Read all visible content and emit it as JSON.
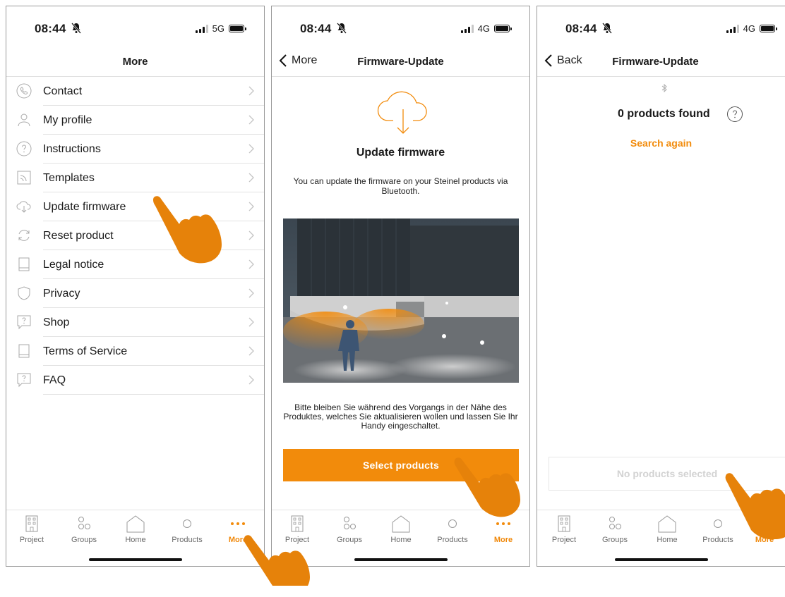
{
  "colors": {
    "accent": "#f28b0b",
    "text": "#1a1a1a",
    "muted": "#6a6a6a",
    "divider": "#e2e2e2"
  },
  "screens": [
    {
      "status": {
        "time": "08:44",
        "network": "5G"
      },
      "nav": {
        "title": "More"
      },
      "menu": [
        {
          "label": "Contact",
          "icon": "phone-icon"
        },
        {
          "label": "My profile",
          "icon": "user-icon"
        },
        {
          "label": "Instructions",
          "icon": "question-icon"
        },
        {
          "label": "Templates",
          "icon": "template-icon"
        },
        {
          "label": "Update firmware",
          "icon": "cloud-icon"
        },
        {
          "label": "Reset product",
          "icon": "reset-icon"
        },
        {
          "label": "Legal notice",
          "icon": "book-icon"
        },
        {
          "label": "Privacy",
          "icon": "shield-icon"
        },
        {
          "label": "Shop",
          "icon": "chat-question-icon"
        },
        {
          "label": "Terms of Service",
          "icon": "book-icon"
        },
        {
          "label": "FAQ",
          "icon": "chat-question-icon"
        }
      ]
    },
    {
      "status": {
        "time": "08:44",
        "network": "4G"
      },
      "nav": {
        "back": "More",
        "title": "Firmware-Update"
      },
      "heading": "Update firmware",
      "description": "You can update the firmware on your Steinel products via Bluetooth.",
      "note": "Bitte bleiben Sie während des Vorgangs in der Nähe des Produktes, welches Sie aktualisieren wollen und lassen Sie Ihr Handy eingeschaltet.",
      "button": "Select products"
    },
    {
      "status": {
        "time": "08:44",
        "network": "4G"
      },
      "nav": {
        "back": "Back",
        "title": "Firmware-Update"
      },
      "found": "0 products found",
      "search_again": "Search again",
      "no_products": "No products selected"
    }
  ],
  "tabs": [
    {
      "label": "Project",
      "icon": "building-icon"
    },
    {
      "label": "Groups",
      "icon": "groups-icon"
    },
    {
      "label": "Home",
      "icon": "home-icon"
    },
    {
      "label": "Products",
      "icon": "circle-icon"
    },
    {
      "label": "More",
      "icon": "more-icon",
      "active": true
    }
  ]
}
